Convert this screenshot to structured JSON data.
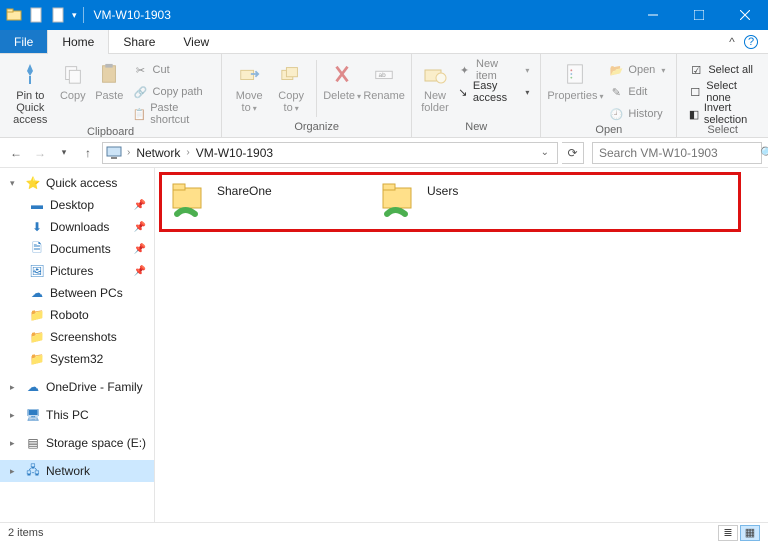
{
  "window": {
    "title": "VM-W10-1903"
  },
  "menu": {
    "file": "File",
    "tabs": [
      "Home",
      "Share",
      "View"
    ],
    "active": 0,
    "collapse_icon": "^",
    "help_icon": "?"
  },
  "ribbon": {
    "clipboard": {
      "label": "Clipboard",
      "pin": "Pin to Quick access",
      "copy": "Copy",
      "paste": "Paste",
      "cut": "Cut",
      "copy_path": "Copy path",
      "paste_shortcut": "Paste shortcut"
    },
    "organize": {
      "label": "Organize",
      "move_to": "Move to",
      "copy_to": "Copy to",
      "delete": "Delete",
      "rename": "Rename"
    },
    "new": {
      "label": "New",
      "new_folder": "New folder",
      "new_item": "New item",
      "easy_access": "Easy access"
    },
    "open": {
      "label": "Open",
      "properties": "Properties",
      "open": "Open",
      "edit": "Edit",
      "history": "History"
    },
    "select": {
      "label": "Select",
      "select_all": "Select all",
      "select_none": "Select none",
      "invert": "Invert selection"
    }
  },
  "breadcrumb": {
    "segments": [
      "Network",
      "VM-W10-1903"
    ]
  },
  "search": {
    "placeholder": "Search VM-W10-1903"
  },
  "sidebar": {
    "quick_access": "Quick access",
    "pinned": [
      "Desktop",
      "Downloads",
      "Documents",
      "Pictures"
    ],
    "recent": [
      "Between PCs",
      "Roboto",
      "Screenshots",
      "System32"
    ],
    "onedrive": "OneDrive - Family",
    "this_pc": "This PC",
    "drive": "Storage space (E:)",
    "network": "Network"
  },
  "content": {
    "items": [
      "ShareOne",
      "Users"
    ]
  },
  "status": {
    "text": "2 items"
  }
}
